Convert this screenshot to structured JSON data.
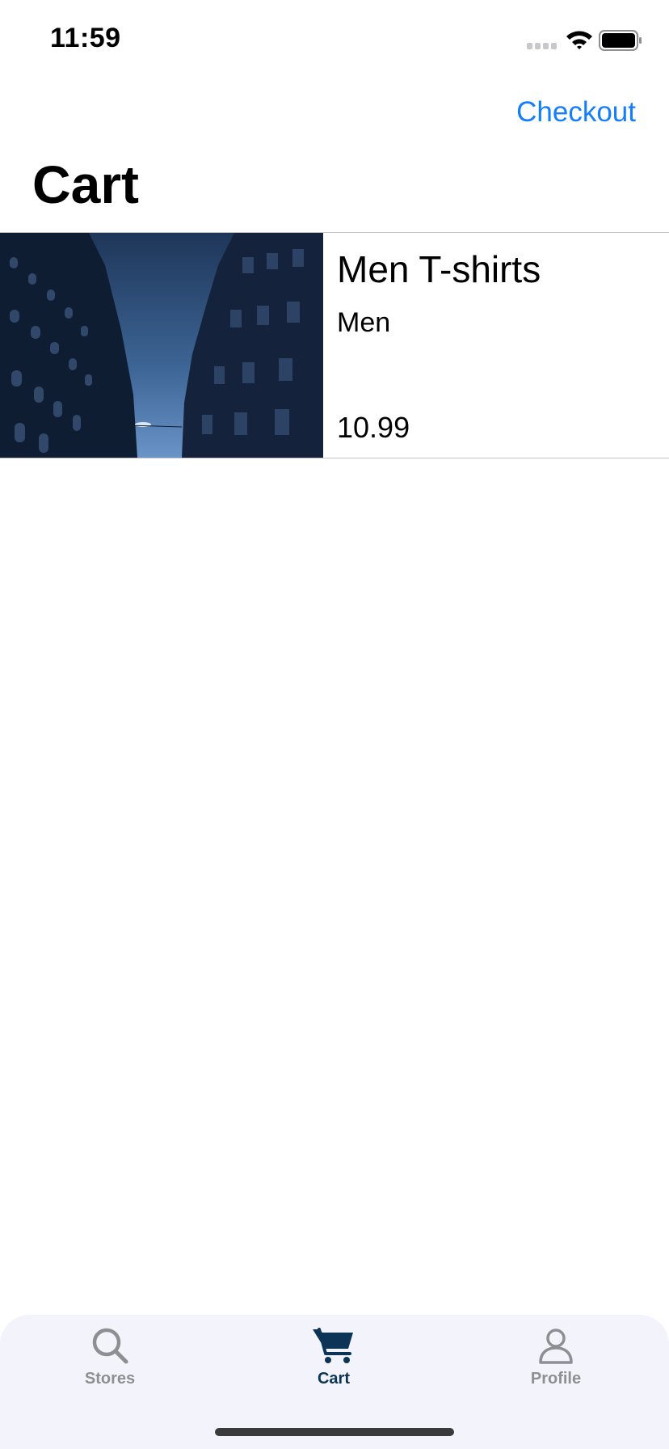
{
  "status_bar": {
    "time": "11:59"
  },
  "header": {
    "checkout_label": "Checkout",
    "title": "Cart"
  },
  "cart": {
    "items": [
      {
        "name": "Men T-shirts",
        "category": "Men",
        "price": "10.99"
      }
    ]
  },
  "tab_bar": {
    "tabs": [
      {
        "label": "Stores",
        "icon": "search-icon",
        "active": false
      },
      {
        "label": "Cart",
        "icon": "cart-icon",
        "active": true
      },
      {
        "label": "Profile",
        "icon": "person-icon",
        "active": false
      }
    ]
  },
  "colors": {
    "accent": "#147efb",
    "tab_active": "#0b3457",
    "tab_inactive": "#8e8e93",
    "tab_bar_background": "#f3f4fb"
  }
}
